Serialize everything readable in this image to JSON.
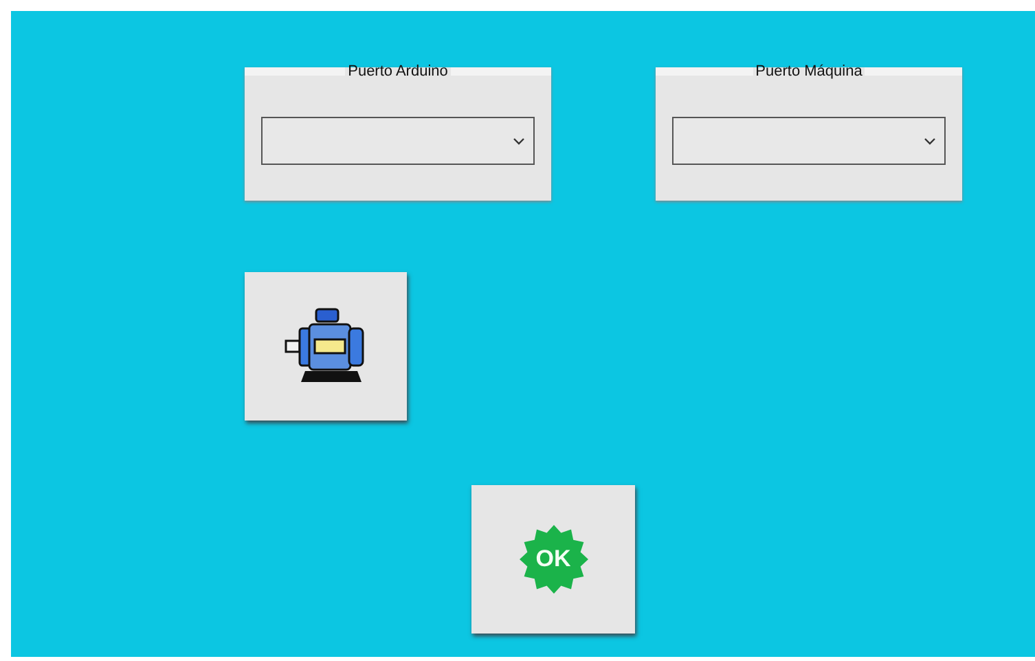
{
  "port_groups": [
    {
      "legend": "Puerto Arduino"
    },
    {
      "legend": "Puerto Máquina"
    }
  ],
  "ok_button": {
    "label": "OK"
  }
}
